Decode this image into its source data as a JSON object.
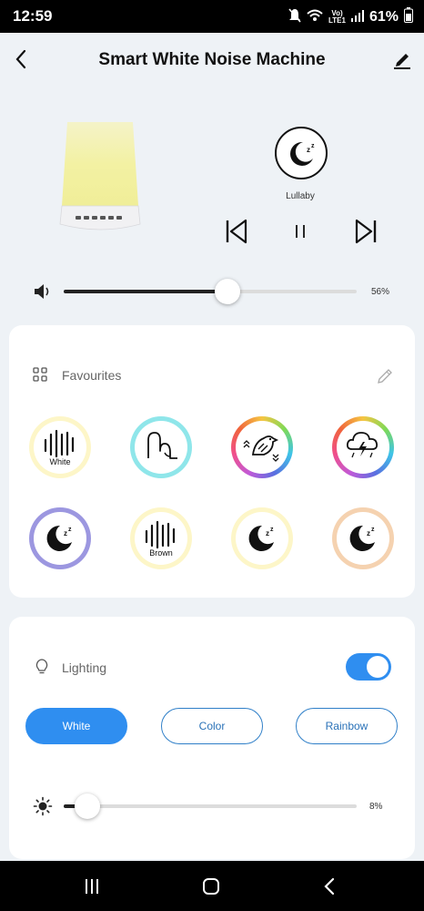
{
  "status": {
    "time": "12:59",
    "network": "Vo)) LTE1",
    "battery": "61%"
  },
  "header": {
    "title": "Smart White Noise Machine"
  },
  "player": {
    "sound_name": "Lullaby",
    "volume_pct": "56%",
    "volume_value": 0.56
  },
  "favourites": {
    "title": "Favourites",
    "items": [
      {
        "name": "white-noise",
        "label": "White",
        "ring": "#fdf6c8"
      },
      {
        "name": "ocean",
        "label": "",
        "ring": "#8fe6ea"
      },
      {
        "name": "bird",
        "label": "",
        "ring": "rainbow"
      },
      {
        "name": "storm",
        "label": "",
        "ring": "rainbow"
      },
      {
        "name": "lullaby-purple",
        "label": "",
        "ring": "#9c97e0"
      },
      {
        "name": "brown-noise",
        "label": "Brown",
        "ring": "#fdf6c8"
      },
      {
        "name": "lullaby-yellow",
        "label": "",
        "ring": "#fdf6c8"
      },
      {
        "name": "lullaby-peach",
        "label": "",
        "ring": "#f5d2b0"
      }
    ]
  },
  "lighting": {
    "title": "Lighting",
    "enabled": true,
    "modes": {
      "white": "White",
      "color": "Color",
      "rainbow": "Rainbow"
    },
    "brightness_pct": "8%",
    "brightness_value": 0.08
  },
  "colors": {
    "accent": "#2f8ef0",
    "background": "#eef2f6"
  }
}
